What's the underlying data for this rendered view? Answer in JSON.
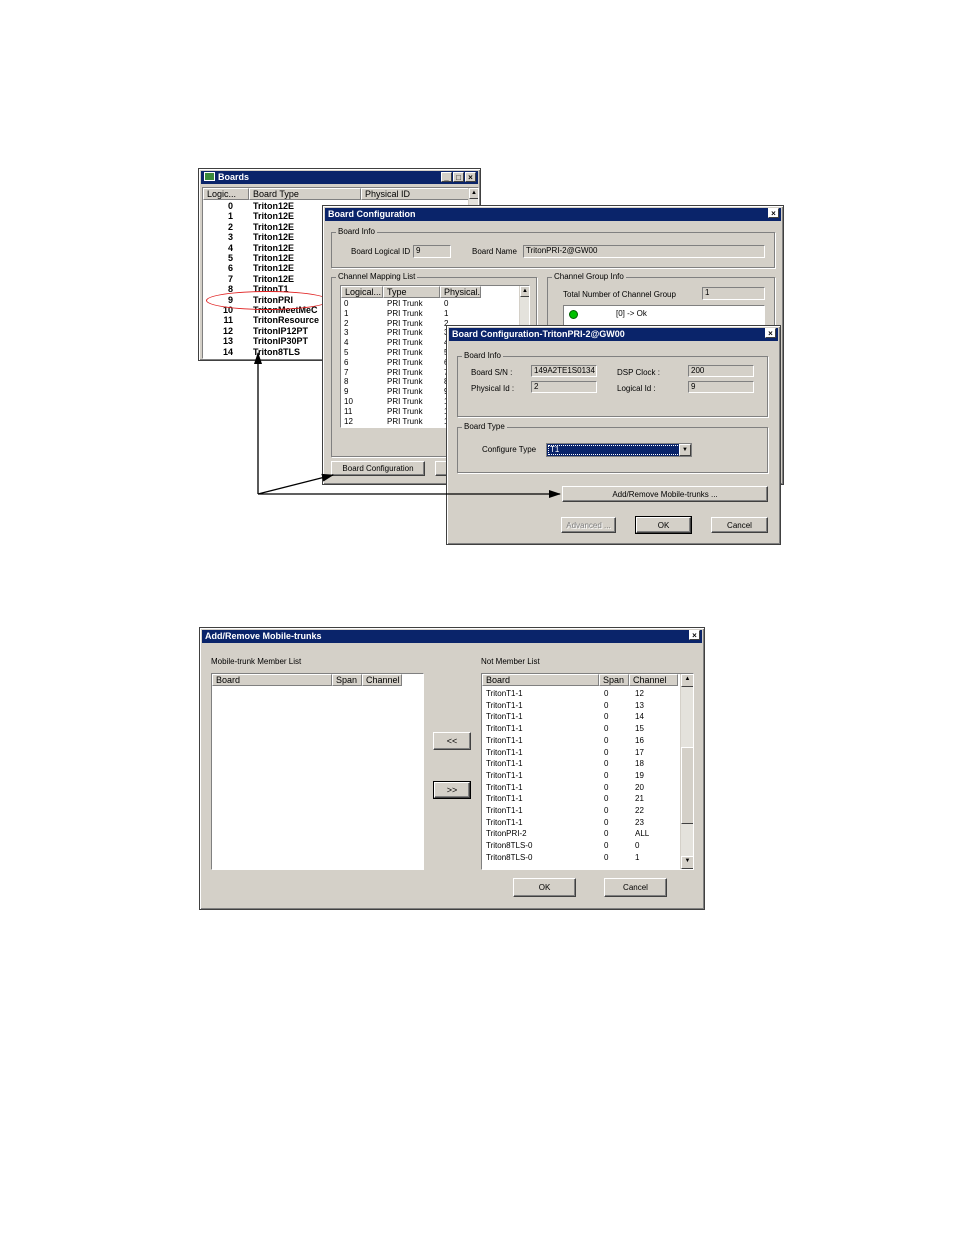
{
  "boards_window": {
    "title": "Boards",
    "columns": [
      "Logic...",
      "Board Type",
      "Physical ID"
    ],
    "rows": [
      {
        "id": "0",
        "type": "Triton12E"
      },
      {
        "id": "1",
        "type": "Triton12E"
      },
      {
        "id": "2",
        "type": "Triton12E"
      },
      {
        "id": "3",
        "type": "Triton12E"
      },
      {
        "id": "4",
        "type": "Triton12E"
      },
      {
        "id": "5",
        "type": "Triton12E"
      },
      {
        "id": "6",
        "type": "Triton12E"
      },
      {
        "id": "7",
        "type": "Triton12E"
      },
      {
        "id": "8",
        "type": "TritonT1"
      },
      {
        "id": "9",
        "type": "TritonPRI"
      },
      {
        "id": "10",
        "type": "TritonMeetMeC"
      },
      {
        "id": "11",
        "type": "TritonResource"
      },
      {
        "id": "12",
        "type": "TritonIP12PT"
      },
      {
        "id": "13",
        "type": "TritonIP30PT"
      },
      {
        "id": "14",
        "type": "Triton8TLS"
      }
    ],
    "highlight_color": "#e02020"
  },
  "board_config": {
    "title": "Board Configuration",
    "board_info_label": "Board Info",
    "logical_id_label": "Board Logical ID",
    "logical_id_value": "9",
    "board_name_label": "Board Name",
    "board_name_value": "TritonPRI-2@GW00",
    "channel_mapping_label": "Channel Mapping List",
    "channel_columns": [
      "Logical...",
      "Type",
      "Physical..."
    ],
    "channel_rows": [
      {
        "logical": "0",
        "type": "PRI Trunk",
        "physical": "0"
      },
      {
        "logical": "1",
        "type": "PRI Trunk",
        "physical": "1"
      },
      {
        "logical": "2",
        "type": "PRI Trunk",
        "physical": "2"
      },
      {
        "logical": "3",
        "type": "PRI Trunk",
        "physical": "3"
      },
      {
        "logical": "4",
        "type": "PRI Trunk",
        "physical": "4"
      },
      {
        "logical": "5",
        "type": "PRI Trunk",
        "physical": "5"
      },
      {
        "logical": "6",
        "type": "PRI Trunk",
        "physical": "6"
      },
      {
        "logical": "7",
        "type": "PRI Trunk",
        "physical": "7"
      },
      {
        "logical": "8",
        "type": "PRI Trunk",
        "physical": "8"
      },
      {
        "logical": "9",
        "type": "PRI Trunk",
        "physical": "9"
      },
      {
        "logical": "10",
        "type": "PRI Trunk",
        "physical": "1"
      },
      {
        "logical": "11",
        "type": "PRI Trunk",
        "physical": "1"
      },
      {
        "logical": "12",
        "type": "PRI Trunk",
        "physical": "1"
      }
    ],
    "channel_group_label": "Channel Group Info",
    "total_groups_label": "Total Number of Channel Group",
    "total_groups_value": "1",
    "group_status": "[0] -> Ok",
    "status_color": "#00c000",
    "board_config_button": "Board Configuration"
  },
  "board_config_t": {
    "title": "Board Configuration-TritonPRI-2@GW00",
    "board_info_label": "Board Info",
    "sn_label": "Board S/N :",
    "sn_value": "149A2TE1S0134",
    "dsp_label": "DSP Clock :",
    "dsp_value": "200",
    "phys_label": "Physical Id :",
    "phys_value": "2",
    "logical_label": "Logical Id :",
    "logical_value": "9",
    "board_type_label": "Board Type",
    "configure_type_label": "Configure Type",
    "configure_type_value": "T1",
    "add_remove_button": "Add/Remove Mobile-trunks ...",
    "advanced_button": "Advanced ...",
    "ok_button": "OK",
    "cancel_button": "Cancel"
  },
  "mobile_trunks": {
    "title": "Add/Remove Mobile-trunks",
    "member_list_label": "Mobile-trunk Member List",
    "not_member_label": "Not Member List",
    "columns": [
      "Board",
      "Span",
      "Channel"
    ],
    "not_member_rows": [
      {
        "board": "TritonT1-1",
        "span": "0",
        "channel": "12"
      },
      {
        "board": "TritonT1-1",
        "span": "0",
        "channel": "13"
      },
      {
        "board": "TritonT1-1",
        "span": "0",
        "channel": "14"
      },
      {
        "board": "TritonT1-1",
        "span": "0",
        "channel": "15"
      },
      {
        "board": "TritonT1-1",
        "span": "0",
        "channel": "16"
      },
      {
        "board": "TritonT1-1",
        "span": "0",
        "channel": "17"
      },
      {
        "board": "TritonT1-1",
        "span": "0",
        "channel": "18"
      },
      {
        "board": "TritonT1-1",
        "span": "0",
        "channel": "19"
      },
      {
        "board": "TritonT1-1",
        "span": "0",
        "channel": "20"
      },
      {
        "board": "TritonT1-1",
        "span": "0",
        "channel": "21"
      },
      {
        "board": "TritonT1-1",
        "span": "0",
        "channel": "22"
      },
      {
        "board": "TritonT1-1",
        "span": "0",
        "channel": "23"
      },
      {
        "board": "TritonPRI-2",
        "span": "0",
        "channel": "ALL"
      },
      {
        "board": "Triton8TLS-0",
        "span": "0",
        "channel": "0"
      },
      {
        "board": "Triton8TLS-0",
        "span": "0",
        "channel": "1"
      }
    ],
    "move_left_button": "<<",
    "move_right_button": ">>",
    "ok_button": "OK",
    "cancel_button": "Cancel"
  }
}
